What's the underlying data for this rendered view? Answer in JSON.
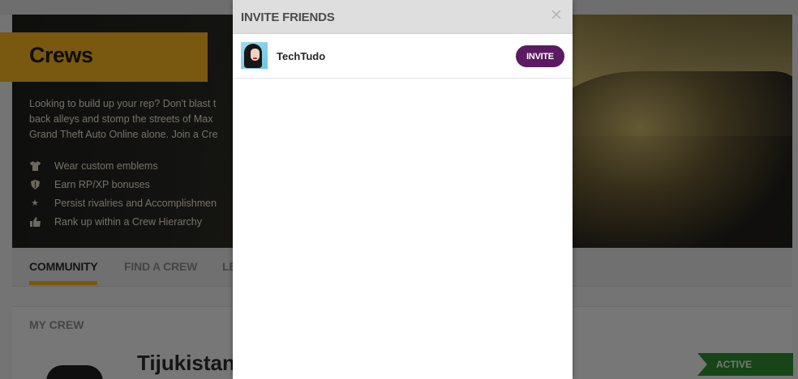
{
  "background_page": {
    "title": "Crews",
    "description_lines": [
      "Looking to build up your rep? Don't blast t",
      "back alleys and stomp the streets of Max",
      "Grand Theft Auto Online alone. Join a Cre"
    ],
    "features": [
      {
        "icon": "tshirt-icon",
        "label": "Wear custom emblems"
      },
      {
        "icon": "shield-icon",
        "label": "Earn RP/XP bonuses"
      },
      {
        "icon": "star-icon",
        "label": "Persist rivalries and Accomplishmen"
      },
      {
        "icon": "thumbs-up-icon",
        "label": "Rank up within a Crew Hierarchy"
      }
    ],
    "tabs": [
      {
        "label": "COMMUNITY",
        "active": true
      },
      {
        "label": "FIND A CREW",
        "active": false
      },
      {
        "label": "LE",
        "active": false
      }
    ],
    "my_crew": {
      "section_label": "MY CREW",
      "crew_name": "Tijukistan",
      "status_badge": "ACTIVE"
    },
    "colors": {
      "accent": "#f2b01e",
      "status_active": "#2f8a2f"
    }
  },
  "modal": {
    "title": "INVITE FRIENDS",
    "close_symbol": "×",
    "friends": [
      {
        "name": "TechTudo",
        "button_label": "INVITE"
      }
    ],
    "colors": {
      "header_bg": "#dedede",
      "invite_button": "#5c1a62"
    }
  }
}
